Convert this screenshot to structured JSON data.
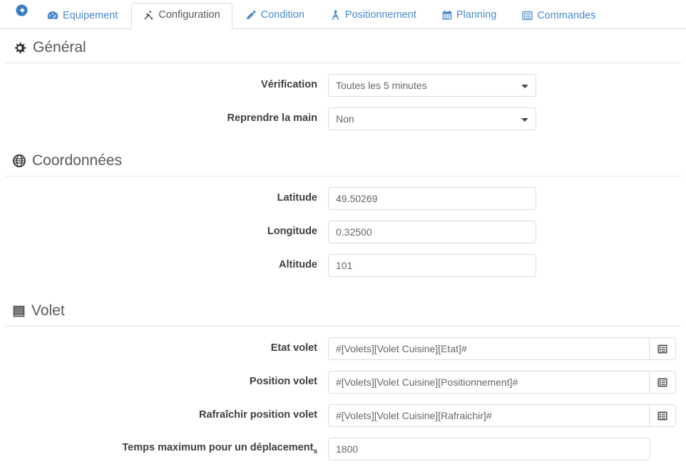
{
  "nav": {
    "back_icon": "arrow-circle-left-icon",
    "tabs": [
      {
        "label": "Equipement",
        "icon": "tachometer-icon",
        "active": false
      },
      {
        "label": "Configuration",
        "icon": "wrench-icon",
        "active": true
      },
      {
        "label": "Condition",
        "icon": "pencil-icon",
        "active": false
      },
      {
        "label": "Positionnement",
        "icon": "sitemap-icon",
        "active": false
      },
      {
        "label": "Planning",
        "icon": "calendar-icon",
        "active": false
      },
      {
        "label": "Commandes",
        "icon": "list-alt-icon",
        "active": false
      }
    ]
  },
  "sections": {
    "general": {
      "title": "Général",
      "icon": "gear-icon",
      "fields": {
        "verification": {
          "label": "Vérification",
          "value": "Toutes les 5 minutes",
          "options": [
            "Toutes les 5 minutes"
          ]
        },
        "reprendre": {
          "label": "Reprendre la main",
          "value": "Non",
          "options": [
            "Non"
          ]
        }
      }
    },
    "coordonnees": {
      "title": "Coordonnées",
      "icon": "globe-icon",
      "fields": {
        "latitude": {
          "label": "Latitude",
          "value": "49.50269"
        },
        "longitude": {
          "label": "Longitude",
          "value": "0.32500"
        },
        "altitude": {
          "label": "Altitude",
          "value": "101"
        }
      }
    },
    "volet": {
      "title": "Volet",
      "icon": "blinds-icon",
      "fields": {
        "etat": {
          "label": "Etat volet",
          "value": "#[Volets][Volet Cuisine][Etat]#",
          "addon_icon": "list-alt-icon"
        },
        "position": {
          "label": "Position volet",
          "value": "#[Volets][Volet Cuisine][Positionnement]#",
          "addon_icon": "list-alt-icon"
        },
        "rafraichir": {
          "label": "Rafraîchir position volet",
          "value": "#[Volets][Volet Cuisine][Rafraichir]#",
          "addon_icon": "list-alt-icon"
        },
        "temps_max": {
          "label": "Temps maximum pour un déplacement",
          "unit": "s",
          "value": "1800"
        }
      }
    }
  },
  "colors": {
    "link_blue": "#4a89c8",
    "text_dark": "#3b3f42",
    "muted": "#666666",
    "border": "#dcdcdc"
  }
}
